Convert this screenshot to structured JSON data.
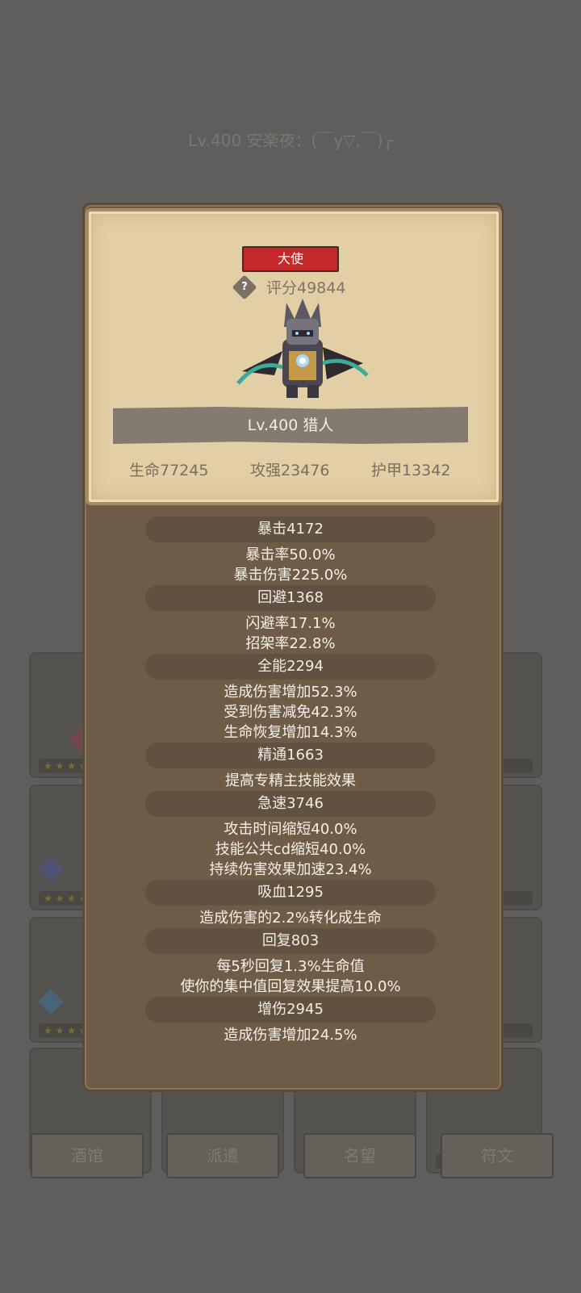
{
  "background": {
    "title": "Lv.400 安楽夜：(￣y▽,￣)╭",
    "buttons": [
      "酒馆",
      "派遣",
      "名望",
      "符文"
    ],
    "star_text": "★ ★ ★ ★"
  },
  "card": {
    "badge": "大使",
    "score_icon": "?",
    "score": "评分49844",
    "level_name": "Lv.400 猎人",
    "stats": [
      "生命77245",
      "攻强23476",
      "护甲13342"
    ]
  },
  "sections": [
    {
      "header": "暴击4172",
      "lines": [
        "暴击率50.0%",
        "暴击伤害225.0%"
      ]
    },
    {
      "header": "回避1368",
      "lines": [
        "闪避率17.1%",
        "招架率22.8%"
      ]
    },
    {
      "header": "全能2294",
      "lines": [
        "造成伤害增加52.3%",
        "受到伤害减免42.3%",
        "生命恢复增加14.3%"
      ]
    },
    {
      "header": "精通1663",
      "lines": [
        "提高专精主技能效果"
      ]
    },
    {
      "header": "急速3746",
      "lines": [
        "攻击时间缩短40.0%",
        "技能公共cd缩短40.0%",
        "持续伤害效果加速23.4%"
      ]
    },
    {
      "header": "吸血1295",
      "lines": [
        "造成伤害的2.2%转化成生命"
      ]
    },
    {
      "header": "回复803",
      "lines": [
        "每5秒回复1.3%生命值",
        "使你的集中值回复效果提高10.0%"
      ]
    },
    {
      "header": "增伤2945",
      "lines": [
        "造成伤害增加24.5%"
      ]
    }
  ],
  "colors": {
    "badge": "#c4282a",
    "panel": "#6e5c47",
    "card": "#e3cfa5"
  }
}
